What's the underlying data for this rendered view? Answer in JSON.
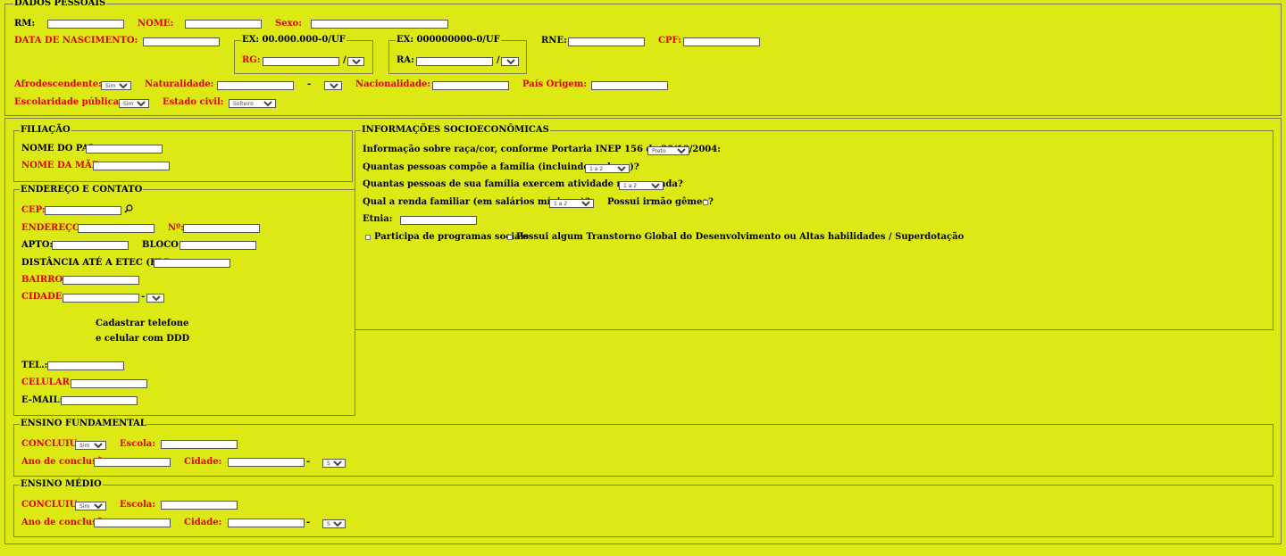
{
  "dados_pessoais": {
    "legend": "DADOS PESSOAIS",
    "rm": "RM:",
    "nome": "NOME:",
    "sexo": "Sexo:",
    "data_nascimento": "DATA DE NASCIMENTO:",
    "rg_legend": "EX: 00.000.000-0/UF",
    "rg": "RG:",
    "ra_legend": "EX: 000000000-0/UF",
    "ra": "RA:",
    "slash": "/",
    "rne": "RNE:",
    "cpf": "CPF:",
    "afrodescendente": "Afrodescendente:",
    "afro_value": "Sim",
    "naturalidade": "Naturalidade:",
    "dash": "-",
    "nacionalidade": "Nacionalidade:",
    "pais_origem": "País Origem:",
    "escolaridade_publica": "Escolaridade pública:",
    "escolaridade_value": "Sim",
    "estado_civil": "Estado civil:",
    "estado_civil_value": "Solteiro"
  },
  "filiacao": {
    "legend": "FILIAÇÃO",
    "nome_pai": "NOME DO PAI:",
    "nome_mae": "NOME DA MÃE:"
  },
  "endereco": {
    "legend": "ENDEREÇO E CONTATO",
    "cep": "CEP:",
    "endereco": "ENDEREÇO:",
    "numero": "Nº:",
    "apto": "APTO:",
    "bloco": "BLOCO:",
    "distancia": "DISTÂNCIA ATÉ A ETEC (KM):",
    "bairro": "BAIRRO:",
    "cidade": "CIDADE:",
    "dash": "-",
    "cadastrar_line1": "Cadastrar telefone",
    "cadastrar_line2": "e celular com DDD",
    "tel": "TEL.:",
    "celular": "CELULAR:",
    "email": "E-MAIL:"
  },
  "socio": {
    "legend": "INFORMAÇÕES SOCIOECONÔMICAS",
    "raca_label": "Informação sobre raça/cor, conforme Portaria INEP 156 de 20/10/2004:",
    "raca_value": "Preto",
    "familia_label": "Quantas pessoas compõe a família (incluindo o aluno)?",
    "familia_value": "1 a 2",
    "remunerada_label": "Quantas pessoas de sua família exercem atividade remunerada?",
    "remunerada_value": "1 a 2",
    "renda_label": "Qual a renda familiar (em salários mínimos)?",
    "renda_value": "1 a 2",
    "gemeo_label": "Possui irmão gêmeo?",
    "etnia_label": "Etnia:",
    "programas_label": "Participa de programas sociais",
    "transtorno_label": "Possui algum Transtorno Global do Desenvolvimento ou Altas habilidades / Superdotação"
  },
  "fundamental": {
    "legend": "ENSINO FUNDAMENTAL",
    "concluiu": "CONCLUIU:",
    "concluiu_value": "Sim",
    "escola": "Escola:",
    "ano": "Ano de conclusão:",
    "cidade": "Cidade:",
    "dash": "-",
    "uf_value": "S"
  },
  "medio": {
    "legend": "ENSINO MÉDIO",
    "concluiu": "CONCLUIU:",
    "concluiu_value": "Sim",
    "escola": "Escola:",
    "ano": "Ano de conclusão:",
    "cidade": "Cidade:",
    "dash": "-",
    "uf_value": "S"
  }
}
